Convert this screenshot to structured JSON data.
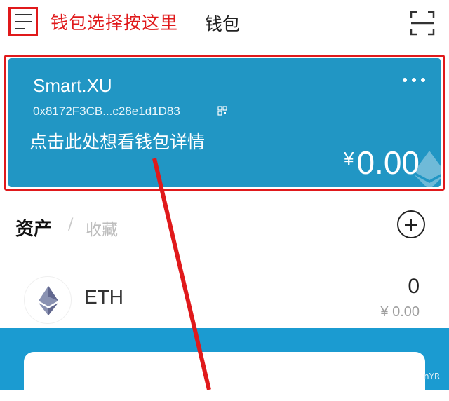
{
  "header": {
    "annotation": "钱包选择按这里",
    "title": "钱包"
  },
  "card": {
    "name": "Smart.XU",
    "address": "0x8172F3CB...c28e1d1D83",
    "hint": "点击此处想看钱包详情",
    "currency": "¥",
    "balance": "0.00"
  },
  "assets": {
    "title": "资产",
    "separator": "/",
    "tab_collect": "收藏",
    "tokens": [
      {
        "symbol": "ETH",
        "amount": "0",
        "value": "¥ 0.00"
      }
    ]
  },
  "watermark": "nYR",
  "colors": {
    "accent": "#2196c4",
    "annotation_red": "#e0191b",
    "bottom_band": "#1b9bd1"
  },
  "icons": [
    "menu-icon",
    "scan-icon",
    "more-icon",
    "qr-code-icon",
    "ethereum-icon",
    "add-icon"
  ]
}
